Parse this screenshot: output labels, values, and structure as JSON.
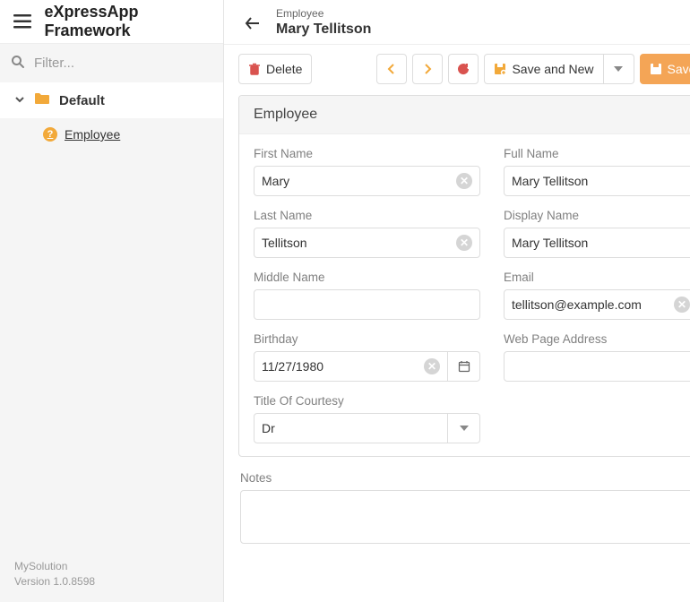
{
  "app": {
    "title": "eXpressApp Framework",
    "solution_name": "MySolution",
    "version": "Version 1.0.8598"
  },
  "sidebar": {
    "filter_placeholder": "Filter...",
    "group_label": "Default",
    "items": [
      {
        "label": "Employee"
      }
    ]
  },
  "header": {
    "supertitle": "Employee",
    "title": "Mary Tellitson"
  },
  "toolbar": {
    "delete_label": "Delete",
    "save_and_new_label": "Save and New",
    "save_label": "Save"
  },
  "panel": {
    "title": "Employee"
  },
  "fields": {
    "first_name": {
      "label": "First Name",
      "value": "Mary"
    },
    "full_name": {
      "label": "Full Name",
      "value": "Mary Tellitson"
    },
    "last_name": {
      "label": "Last Name",
      "value": "Tellitson"
    },
    "display_name": {
      "label": "Display Name",
      "value": "Mary Tellitson"
    },
    "middle_name": {
      "label": "Middle Name",
      "value": ""
    },
    "email": {
      "label": "Email",
      "value": "tellitson@example.com"
    },
    "birthday": {
      "label": "Birthday",
      "value": "11/27/1980"
    },
    "web_page": {
      "label": "Web Page Address",
      "value": ""
    },
    "title_of_courtesy": {
      "label": "Title Of Courtesy",
      "value": "Dr"
    },
    "notes": {
      "label": "Notes",
      "value": ""
    }
  }
}
